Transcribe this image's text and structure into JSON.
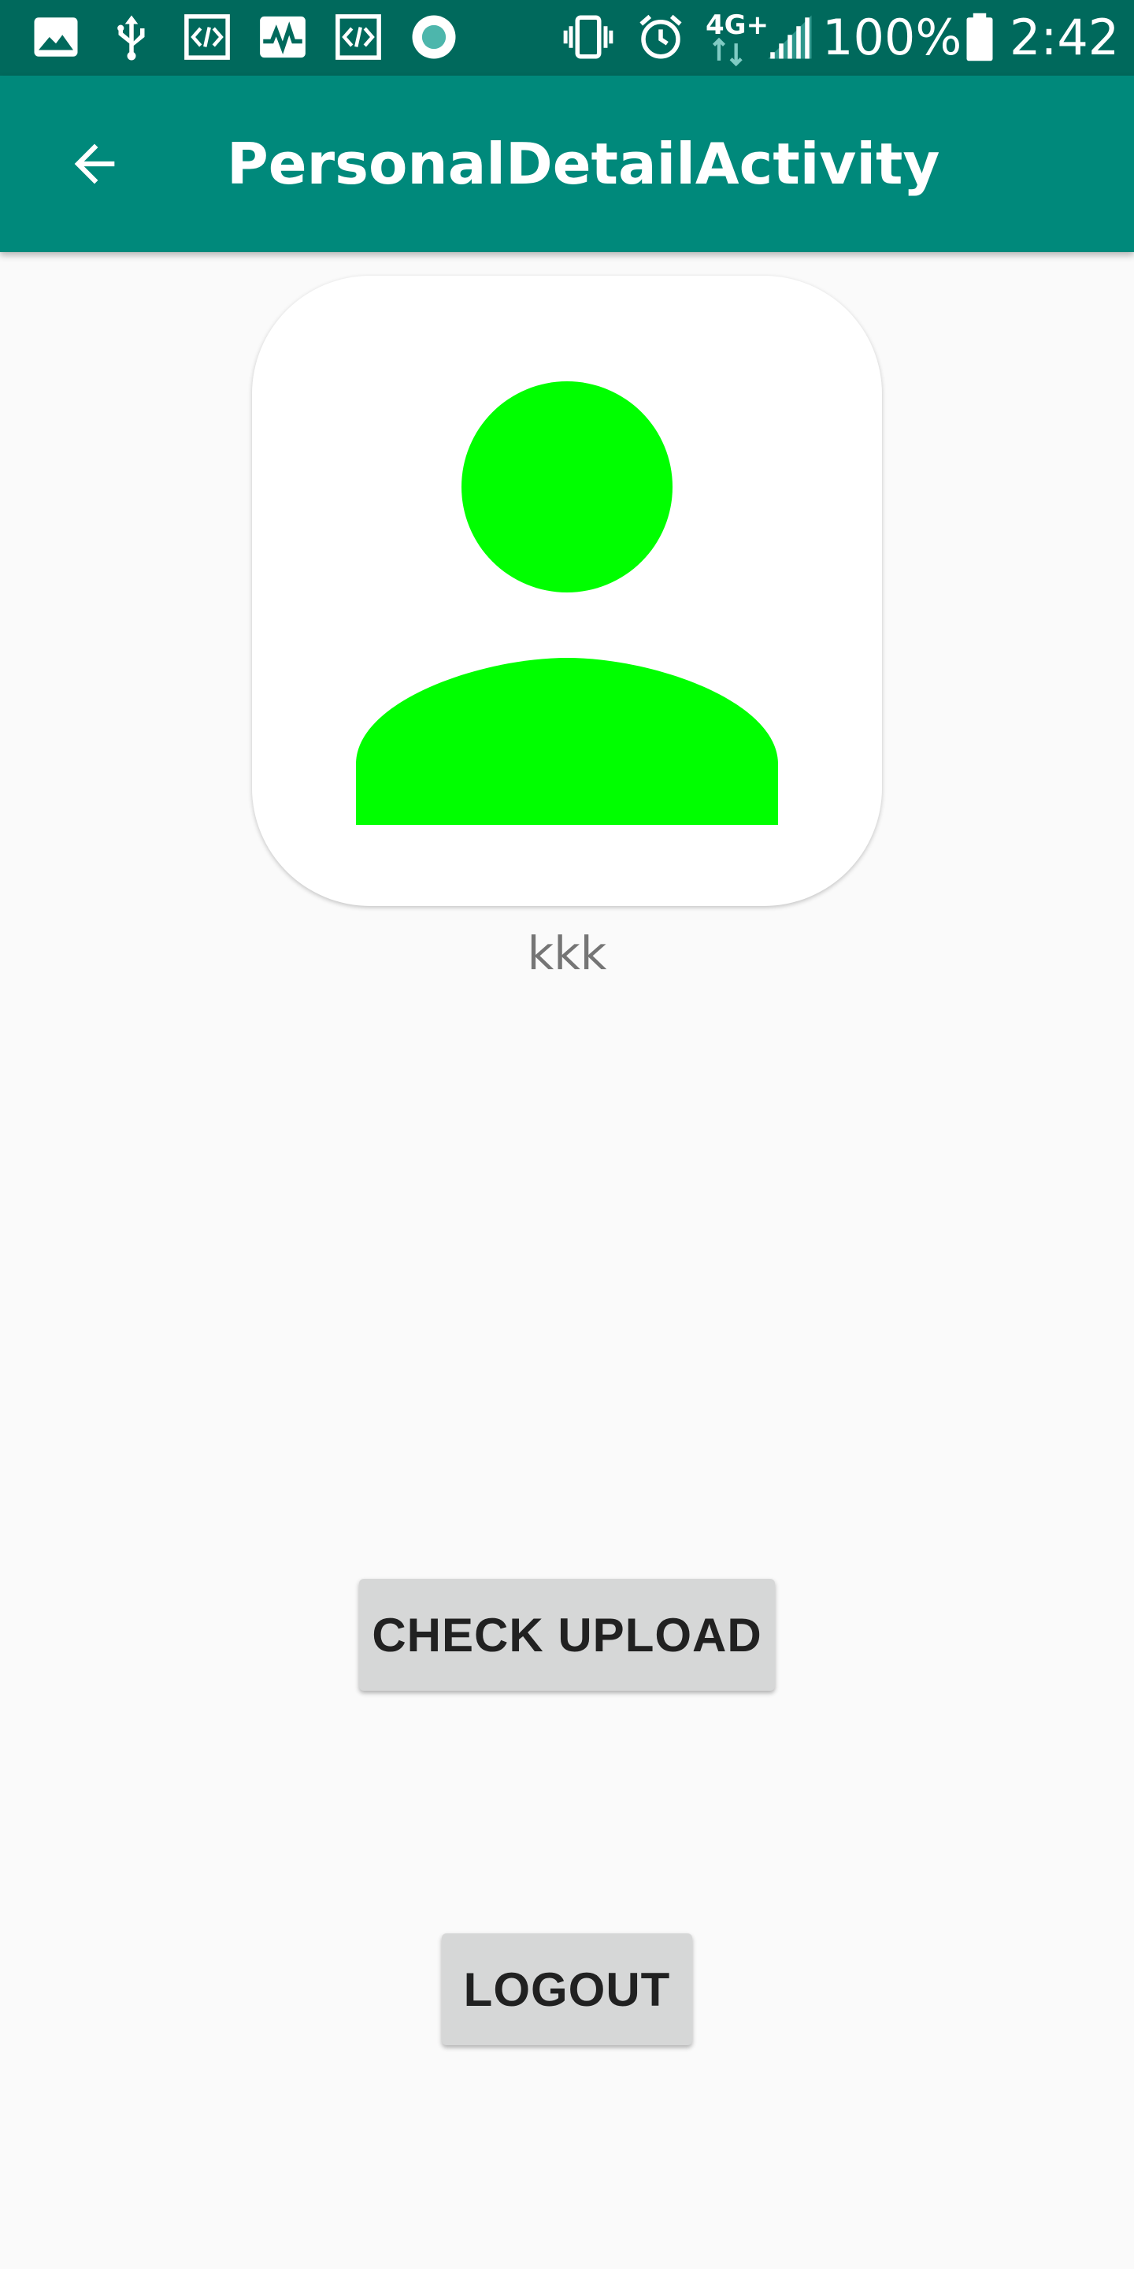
{
  "status_bar": {
    "battery_percent": "100%",
    "time": "2:42",
    "network_type": "4G+",
    "icons": [
      "image-icon",
      "usb-icon",
      "code-icon",
      "activity-icon",
      "code-icon",
      "record-icon",
      "vibrate-icon",
      "alarm-icon",
      "network-4g-icon",
      "signal-icon",
      "battery-icon"
    ]
  },
  "app_bar": {
    "title": "PersonalDetailActivity",
    "back_icon": "arrow-back-icon"
  },
  "profile": {
    "avatar_icon": "person-icon",
    "username": "kkk"
  },
  "buttons": {
    "check_upload_label": "CHECK UPLOAD",
    "logout_label": "LOGOUT"
  },
  "colors": {
    "status_bar": "#00695c",
    "app_bar": "#00897b",
    "avatar": "#00ff00",
    "background": "#fafafa",
    "button": "#d6d7d7"
  }
}
